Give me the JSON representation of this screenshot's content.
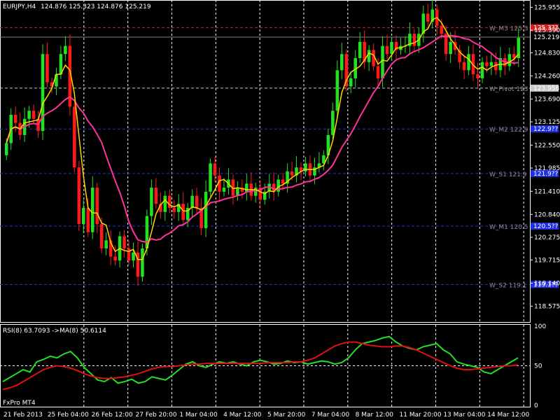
{
  "chart_data": [
    {
      "type": "candlestick",
      "symbol_header": "EURJPY,H4",
      "ohlc_header": "124.876 125.323 124.876 125.219",
      "current_price": "125.219",
      "ylim": [
        118.2,
        126.1
      ],
      "y_ticks": [
        "125.955",
        "125.390",
        "124.830",
        "124.260",
        "123.690",
        "123.125",
        "122.550",
        "121.985",
        "121.410",
        "120.840",
        "120.275",
        "119.715",
        "119.140",
        "118.575"
      ],
      "x_ticks": [
        "21 Feb 2013",
        "25 Feb 04:00",
        "26 Feb 12:00",
        "27 Feb 20:00",
        "1 Mar 04:00",
        "4 Mar 12:00",
        "5 Mar 20:00",
        "7 Mar 04:00",
        "8 Mar 12:00",
        "11 Mar 20:00",
        "13 Mar 04:00",
        "14 Mar 12:00"
      ],
      "levels": [
        {
          "name": "W_M3 125.3",
          "price": 125.45,
          "marker": "125.3??",
          "color": "#d02020"
        },
        {
          "name": "",
          "price": 125.219,
          "marker": "125.219",
          "color": "#808080"
        },
        {
          "name": "W_Pivot 123",
          "price": 123.958,
          "marker": "123.958",
          "color": "#c8c8c8"
        },
        {
          "name": "W_M2 122.9",
          "price": 122.95,
          "marker": "122.9??",
          "color": "#2030e0"
        },
        {
          "name": "W_S1 121.9",
          "price": 121.85,
          "marker": "121.9??",
          "color": "#2030e0"
        },
        {
          "name": "W_M1 120.5",
          "price": 120.55,
          "marker": "120.5??",
          "color": "#2030e0"
        },
        {
          "name": "W_S2 119.1",
          "price": 119.11,
          "marker": "119.1??",
          "color": "#2030e0"
        }
      ],
      "candles_close": [
        122.6,
        123.3,
        123.1,
        122.8,
        123.2,
        123.4,
        123.2,
        122.9,
        124.8,
        124.1,
        124.0,
        124.3,
        124.8,
        125.0,
        123.5,
        122.0,
        120.6,
        121.0,
        120.4,
        121.5,
        120.6,
        120.0,
        120.2,
        119.8,
        119.7,
        120.3,
        120.0,
        119.7,
        119.9,
        119.3,
        120.0,
        120.8,
        121.5,
        121.1,
        120.9,
        121.3,
        121.0,
        120.9,
        121.1,
        120.7,
        121.0,
        121.3,
        121.0,
        120.5,
        121.4,
        122.1,
        121.8,
        121.4,
        121.5,
        121.7,
        121.3,
        121.5,
        121.4,
        121.6,
        121.3,
        121.5,
        121.2,
        121.4,
        121.6,
        121.4,
        121.7,
        121.6,
        121.9,
        121.8,
        122.0,
        121.9,
        122.1,
        121.8,
        122.0,
        122.1,
        122.3,
        122.8,
        123.4,
        124.4,
        124.8,
        124.0,
        124.2,
        124.7,
        125.1,
        124.6,
        124.9,
        124.5,
        124.2,
        125.0,
        124.8,
        125.1,
        124.9,
        125.0,
        125.0,
        125.3,
        125.0,
        125.3,
        125.8,
        125.6,
        125.9,
        125.5,
        125.3,
        124.8,
        125.1,
        124.9,
        124.6,
        124.4,
        124.8,
        124.3,
        124.2,
        124.6,
        124.5,
        124.6,
        124.4,
        124.7,
        124.5,
        124.8,
        124.7,
        125.2
      ],
      "ma_fast": {
        "color": "#ffd700"
      },
      "ma_slow": {
        "color": "#ff3399"
      }
    },
    {
      "type": "line",
      "header": "RSI(8) 63.7093  ->MA(8) 50.6114",
      "ylim": [
        0,
        100
      ],
      "y_ticks": [
        "100",
        "50",
        "0"
      ],
      "series": [
        {
          "name": "RSI(8) 63.7093",
          "color": "#22e022",
          "values": [
            30,
            35,
            40,
            45,
            42,
            55,
            58,
            62,
            60,
            65,
            68,
            60,
            48,
            40,
            32,
            30,
            35,
            28,
            30,
            33,
            28,
            30,
            36,
            34,
            32,
            38,
            45,
            52,
            55,
            50,
            48,
            52,
            55,
            53,
            55,
            52,
            50,
            55,
            57,
            55,
            52,
            53,
            56,
            54,
            55,
            52,
            54,
            56,
            55,
            52,
            54,
            60,
            70,
            78,
            80,
            82,
            85,
            87,
            80,
            75,
            72,
            70,
            74,
            76,
            78,
            70,
            65,
            55,
            52,
            50,
            48,
            42,
            40,
            45,
            50,
            55,
            60
          ]
        },
        {
          "name": "->MA(8) 50.6114",
          "color": "#e01010",
          "values": [
            20,
            22,
            25,
            30,
            35,
            40,
            45,
            48,
            50,
            49,
            47,
            44,
            40,
            37,
            35,
            34,
            34,
            35,
            36,
            38,
            40,
            43,
            46,
            48,
            49,
            49,
            50,
            51,
            52,
            52,
            53,
            53,
            53,
            53,
            53,
            53,
            53,
            53,
            53,
            54,
            54,
            54,
            54,
            55,
            55,
            57,
            60,
            65,
            70,
            75,
            78,
            80,
            80,
            78,
            76,
            75,
            74,
            74,
            75,
            75,
            73,
            70,
            66,
            62,
            58,
            54,
            50,
            47,
            45,
            45,
            46,
            47,
            48,
            49,
            50,
            50,
            51
          ]
        }
      ]
    }
  ],
  "footer_label": "FxPro MT4",
  "rsi_level": 50
}
